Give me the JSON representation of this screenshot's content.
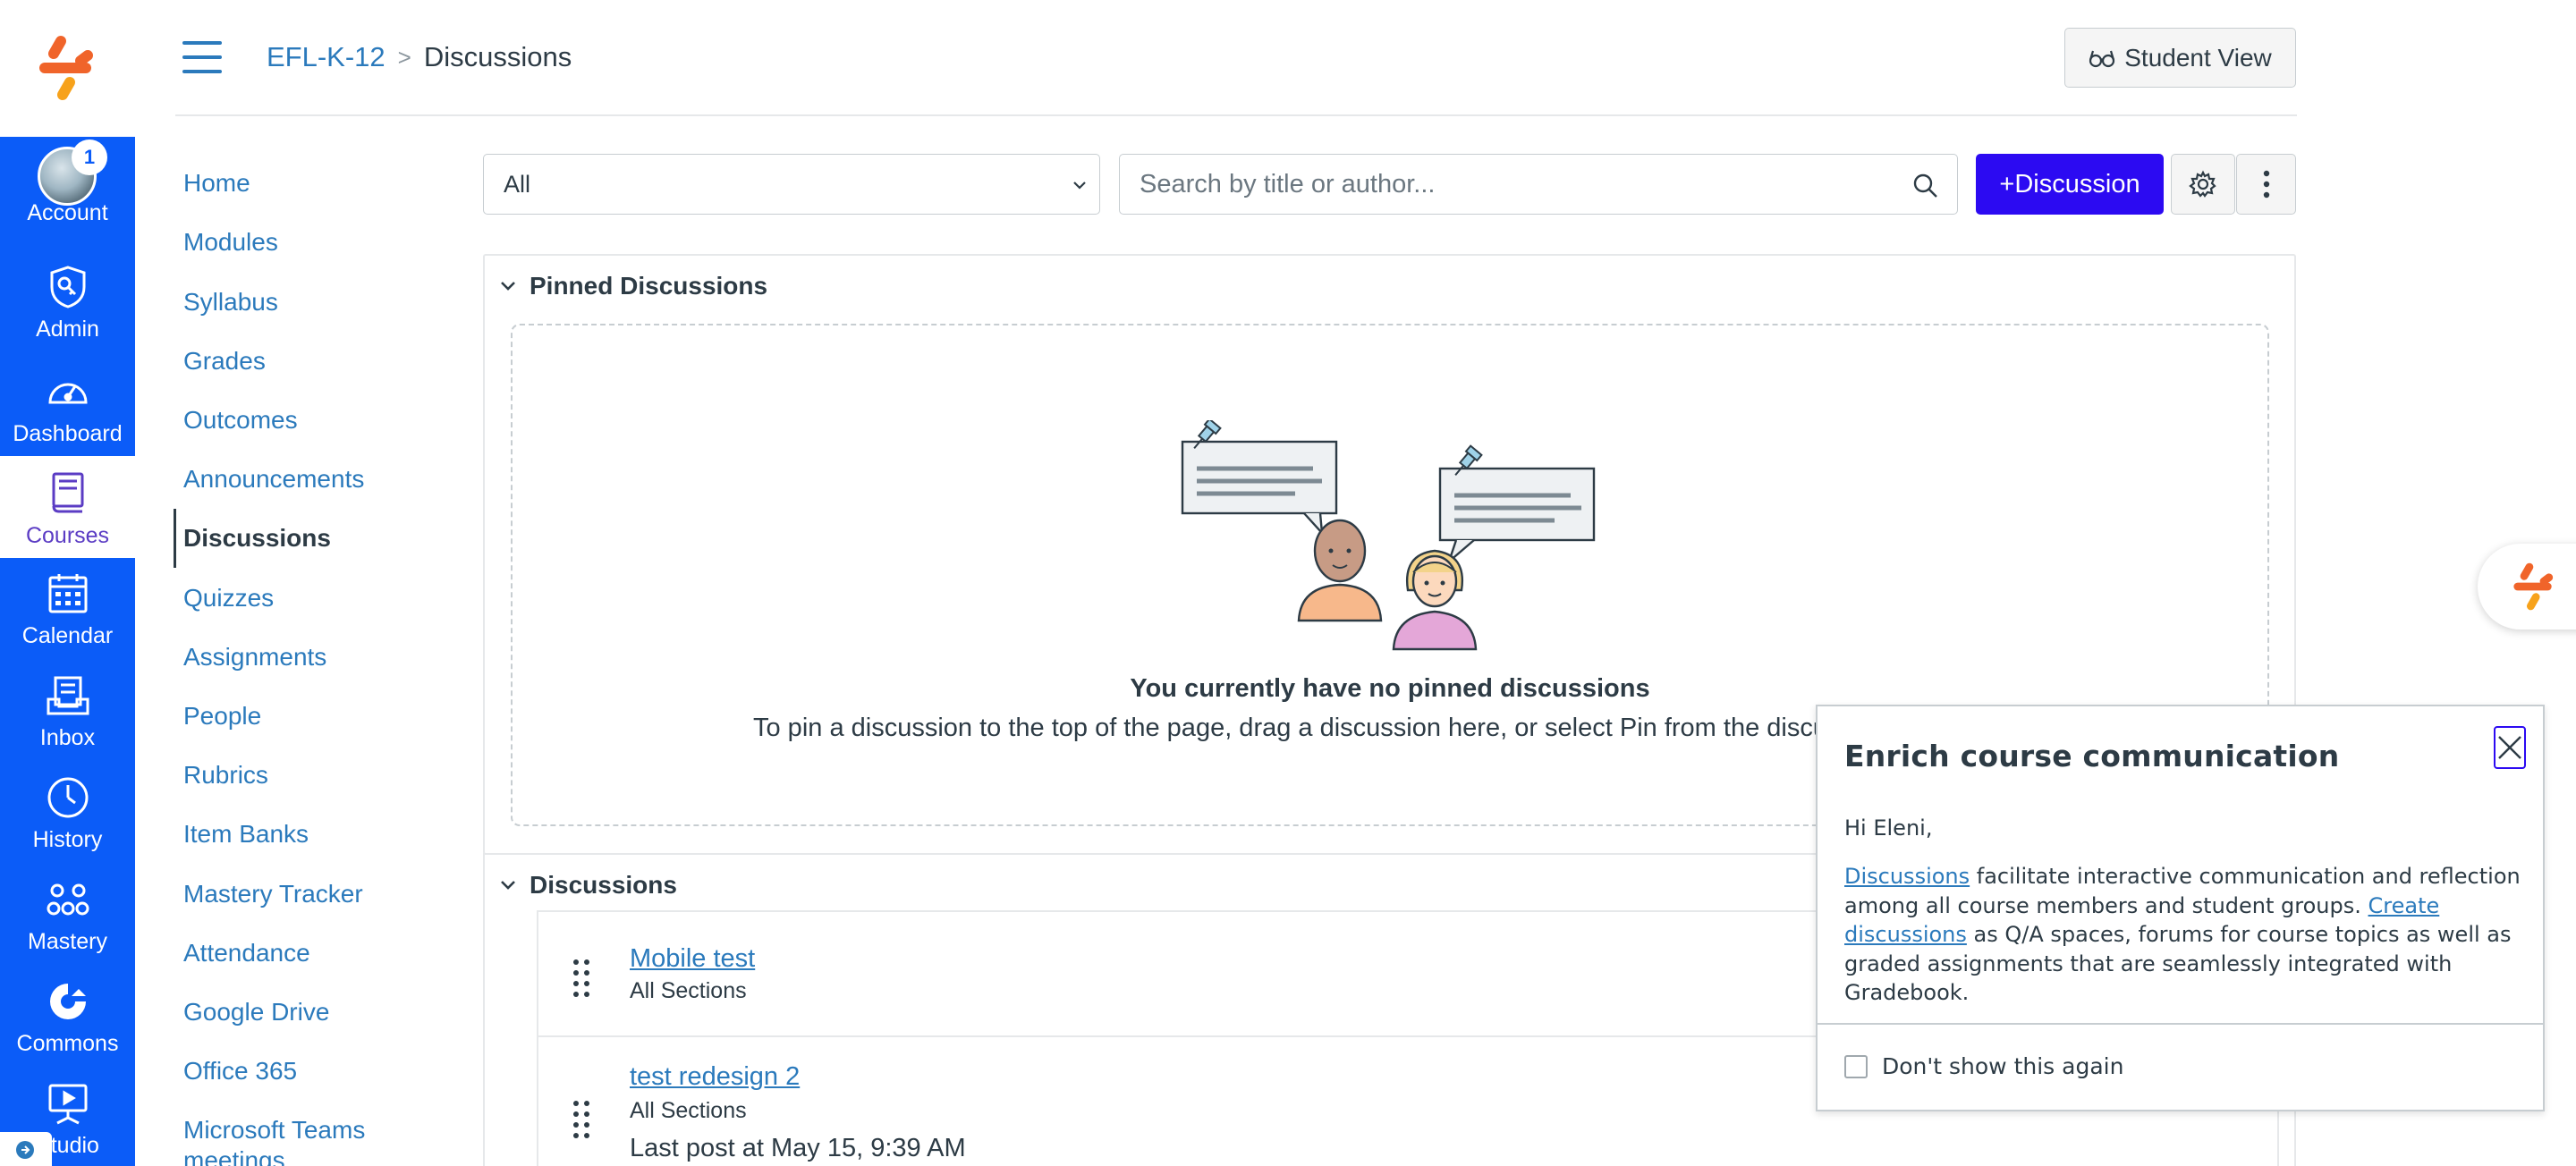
{
  "global_nav": {
    "account_badge": "1",
    "items": [
      {
        "label": "Account",
        "icon": "avatar"
      },
      {
        "label": "Admin",
        "icon": "shield-key-icon"
      },
      {
        "label": "Dashboard",
        "icon": "speedometer-icon"
      },
      {
        "label": "Courses",
        "icon": "book-icon"
      },
      {
        "label": "Calendar",
        "icon": "calendar-icon"
      },
      {
        "label": "Inbox",
        "icon": "inbox-icon"
      },
      {
        "label": "History",
        "icon": "clock-icon"
      },
      {
        "label": "Mastery",
        "icon": "mastery-icon"
      },
      {
        "label": "Commons",
        "icon": "commons-icon"
      },
      {
        "label": "Studio",
        "icon": "studio-icon"
      }
    ],
    "accent_color": "#0b5cf8",
    "active_color": "#5b3cc4"
  },
  "header": {
    "breadcrumb": {
      "course": "EFL-K-12",
      "separator": ">",
      "current": "Discussions"
    },
    "student_view_label": "Student View"
  },
  "course_nav": {
    "items": [
      {
        "label": "Home"
      },
      {
        "label": "Modules"
      },
      {
        "label": "Syllabus"
      },
      {
        "label": "Grades"
      },
      {
        "label": "Outcomes"
      },
      {
        "label": "Announcements"
      },
      {
        "label": "Discussions",
        "active": true
      },
      {
        "label": "Quizzes"
      },
      {
        "label": "Assignments"
      },
      {
        "label": "People"
      },
      {
        "label": "Rubrics"
      },
      {
        "label": "Item Banks"
      },
      {
        "label": "Mastery Tracker"
      },
      {
        "label": "Attendance"
      },
      {
        "label": "Google Drive"
      },
      {
        "label": "Office 365"
      },
      {
        "label": "Microsoft Teams meetings"
      }
    ]
  },
  "toolbar": {
    "filter_value": "All",
    "search_placeholder": "Search by title or author...",
    "add_button_label": "+Discussion",
    "add_button_color": "#2c0af2"
  },
  "pinned": {
    "section_title": "Pinned Discussions",
    "empty_title": "You currently have no pinned discussions",
    "empty_desc": "To pin a discussion to the top of the page, drag a discussion here, or select Pin from the discussion settings menu."
  },
  "discussions": {
    "section_title": "Discussions",
    "items": [
      {
        "title": "Mobile test",
        "sections": "All Sections"
      },
      {
        "title": "test redesign 2",
        "sections": "All Sections",
        "last_post": "Last post at May 15, 9:39 AM"
      }
    ]
  },
  "popover": {
    "title": "Enrich course communication",
    "greeting": "Hi Eleni,",
    "link1": "Discussions",
    "text1": " facilitate interactive communication and reflection among all course members and student groups. ",
    "link2": "Create discussions",
    "text2": " as Q/A spaces, forums for course topics as well as graded assignments that are seamlessly integrated with Gradebook.",
    "checkbox_label": "Don't show this again"
  }
}
